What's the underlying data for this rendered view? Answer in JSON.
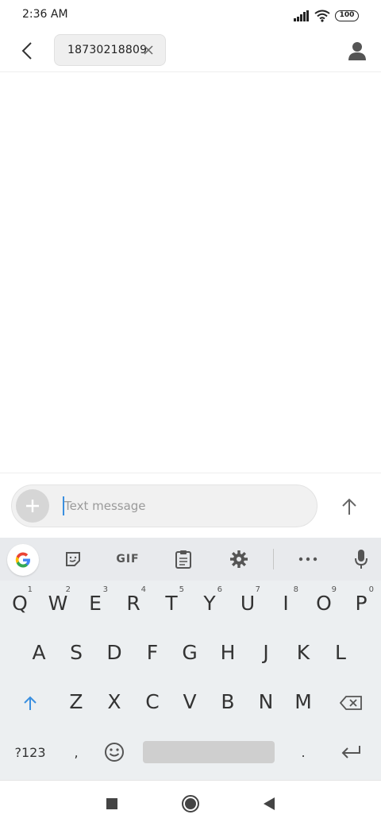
{
  "status_bar": {
    "time": "2:36 AM",
    "battery": "100"
  },
  "app_bar": {
    "recipient": "18730218809"
  },
  "composer": {
    "placeholder": "Text message"
  },
  "keyboard": {
    "toolbar": {
      "gif_label": "GIF"
    },
    "row1": [
      {
        "key": "Q",
        "hint": "1"
      },
      {
        "key": "W",
        "hint": "2"
      },
      {
        "key": "E",
        "hint": "3"
      },
      {
        "key": "R",
        "hint": "4"
      },
      {
        "key": "T",
        "hint": "5"
      },
      {
        "key": "Y",
        "hint": "6"
      },
      {
        "key": "U",
        "hint": "7"
      },
      {
        "key": "I",
        "hint": "8"
      },
      {
        "key": "O",
        "hint": "9"
      },
      {
        "key": "P",
        "hint": "0"
      }
    ],
    "row2": [
      "A",
      "S",
      "D",
      "F",
      "G",
      "H",
      "J",
      "K",
      "L"
    ],
    "row3": [
      "Z",
      "X",
      "C",
      "V",
      "B",
      "N",
      "M"
    ],
    "row4": {
      "symbols": "?123",
      "comma": ",",
      "period": "."
    }
  },
  "colors": {
    "accent": "#3a8fe0",
    "keyboard_bg": "#eceff1"
  }
}
